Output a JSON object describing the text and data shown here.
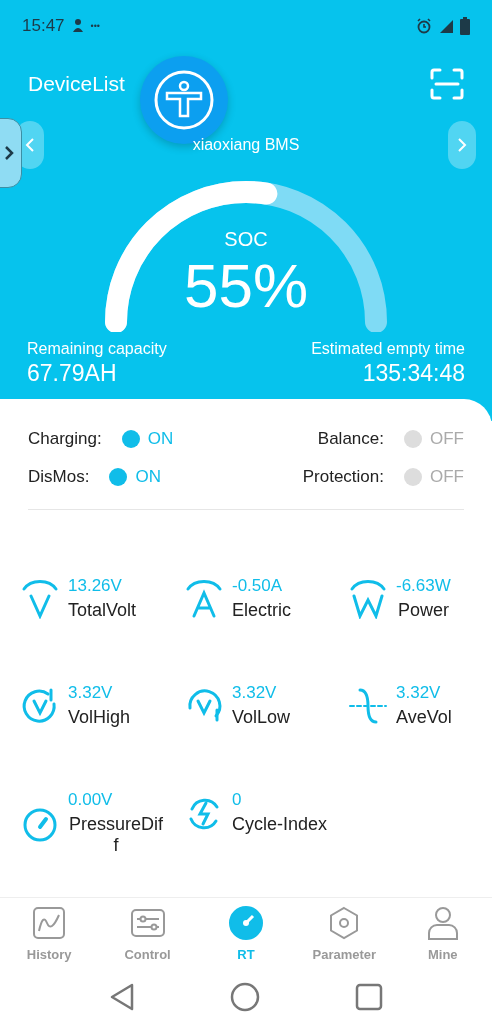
{
  "status_bar": {
    "time": "15:47",
    "dots": "•••"
  },
  "header": {
    "title": "DeviceList"
  },
  "device": {
    "name": "xiaoxiang BMS"
  },
  "gauge": {
    "label": "SOC",
    "value": "55%"
  },
  "capacity": {
    "label": "Remaining capacity",
    "value": "67.79AH"
  },
  "empty_time": {
    "label": "Estimated empty time",
    "value": "135:34:48"
  },
  "switches": [
    {
      "label": "Charging:",
      "state": "ON",
      "on": true
    },
    {
      "label": "Balance:",
      "state": "OFF",
      "on": false
    },
    {
      "label": "DisMos:",
      "state": "ON",
      "on": true
    },
    {
      "label": "Protection:",
      "state": "OFF",
      "on": false
    }
  ],
  "metrics": [
    {
      "kind": "volt",
      "value": "13.26V",
      "label": "TotalVolt"
    },
    {
      "kind": "amp",
      "value": "-0.50A",
      "label": "Electric"
    },
    {
      "kind": "watt",
      "value": "-6.63W",
      "label": "Power"
    },
    {
      "kind": "high",
      "value": "3.32V",
      "label": "VolHigh"
    },
    {
      "kind": "low",
      "value": "3.32V",
      "label": "VolLow"
    },
    {
      "kind": "avg",
      "value": "3.32V",
      "label": "AveVol"
    },
    {
      "kind": "diff",
      "value": "0.00V",
      "label": "PressureDiff"
    },
    {
      "kind": "cycle",
      "value": "0",
      "label": "Cycle-Index"
    }
  ],
  "tabs": [
    {
      "kind": "history",
      "label": "History",
      "selected": false
    },
    {
      "kind": "control",
      "label": "Control",
      "selected": false
    },
    {
      "kind": "rt",
      "label": "RT",
      "selected": true
    },
    {
      "kind": "parameter",
      "label": "Parameter",
      "selected": false
    },
    {
      "kind": "mine",
      "label": "Mine",
      "selected": false
    }
  ]
}
